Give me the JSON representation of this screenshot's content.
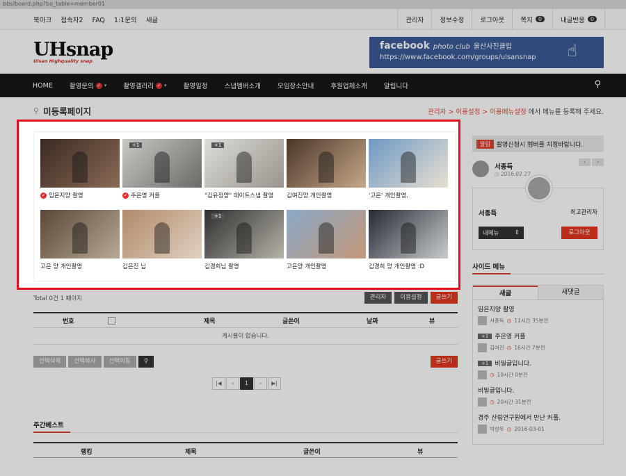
{
  "url": "bbs/board.php?bo_table=member01",
  "topbar": {
    "left": [
      "북마크",
      "접속자2",
      "FAQ",
      "1:1문의",
      "새글"
    ],
    "right": [
      {
        "label": "관리자",
        "count": null
      },
      {
        "label": "정보수정",
        "count": null
      },
      {
        "label": "로그아웃",
        "count": null
      },
      {
        "label": "쪽지",
        "count": "0"
      },
      {
        "label": "내글반응",
        "count": "0"
      }
    ]
  },
  "logo": {
    "main": "UHsnap",
    "sub": "Ulsan Highquality snap"
  },
  "banner": {
    "title": "facebook",
    "title2": "photo club",
    "korean": "울산사진클럽",
    "url": "https://www.facebook.com/groups/ulsansnap"
  },
  "nav": {
    "items": [
      {
        "label": "HOME",
        "check": false,
        "caret": false
      },
      {
        "label": "촬영문의",
        "check": true,
        "caret": true
      },
      {
        "label": "촬영갤러리",
        "check": true,
        "caret": true
      },
      {
        "label": "촬영일정",
        "check": false,
        "caret": false
      },
      {
        "label": "스냅멤버소개",
        "check": false,
        "caret": false
      },
      {
        "label": "모임장소안내",
        "check": false,
        "caret": false
      },
      {
        "label": "후원업체소개",
        "check": false,
        "caret": false
      },
      {
        "label": "알립니다",
        "check": false,
        "caret": false
      }
    ]
  },
  "page": {
    "title": "미등록페이지",
    "path_red": "관리자 > 이용설정 > 이용메뉴설정",
    "path_rest": " 에서 메뉴를 등록해 주세요."
  },
  "gallery": [
    {
      "caption": "임은지양 촬영",
      "check": true,
      "plus": ""
    },
    {
      "caption": "주은영 커플",
      "check": true,
      "plus": "+1"
    },
    {
      "caption": "\"김유정양\" 데이트스냅 촬영",
      "check": false,
      "plus": "+1"
    },
    {
      "caption": "김여진양 개인촬영",
      "check": false,
      "plus": ""
    },
    {
      "caption": "'고은' 개인촬영.",
      "check": false,
      "plus": ""
    },
    {
      "caption": "고은 양 개인촬영",
      "check": false,
      "plus": ""
    },
    {
      "caption": "김은진 님",
      "check": false,
      "plus": ""
    },
    {
      "caption": "김경희님 촬영",
      "check": false,
      "plus": "+1"
    },
    {
      "caption": "고은양 개인촬영",
      "check": false,
      "plus": ""
    },
    {
      "caption": "김경희 양 개인촬영 :D",
      "check": false,
      "plus": ""
    }
  ],
  "board": {
    "total": "Total 0건 1 페이지",
    "btn_admin": "관리자",
    "btn_settings": "이용설정",
    "btn_write": "글쓰기",
    "cols": [
      "번호",
      "제목",
      "글쓴이",
      "날짜",
      "뷰"
    ],
    "empty": "게시물이 없습니다.",
    "btn_delete": "선택삭제",
    "btn_copy": "선택복사",
    "btn_move": "선택이동",
    "pager": [
      "|◀",
      "‹",
      "1",
      "›",
      "▶|"
    ]
  },
  "weekly": {
    "title": "주간베스트",
    "cols": [
      "랭킹",
      "제목",
      "글쓴이",
      "뷰"
    ]
  },
  "sidebar": {
    "notice_tag": "알림",
    "notice": "촬영신청시 멤버를 지정바랍니다.",
    "author_name": "서종득",
    "author_date": "2016.02.27",
    "profile_name": "서종득",
    "profile_role": "최고관리자",
    "my_menu": "내메뉴",
    "logout": "로그아웃",
    "side_menu_title": "사이드 메뉴",
    "tab_new": "새글",
    "tab_comments": "새댓글",
    "recent": [
      {
        "title": "임은지양 촬영",
        "plus": "",
        "author": "서종득",
        "time": "11시간 35분전"
      },
      {
        "title": "주은영 커플",
        "plus": "+1",
        "author": "김여진",
        "time": "16시간 7분전"
      },
      {
        "title": "비밀글입니다.",
        "plus": "+1",
        "author": "",
        "time": "19시간 0분전"
      },
      {
        "title": "비밀글입니다.",
        "plus": "",
        "author": "",
        "time": "20시간 31분전"
      },
      {
        "title": "경주 산림연구원에서 만난 커플.",
        "plus": "",
        "author": "박성우",
        "time": "2016-03-01"
      }
    ]
  }
}
